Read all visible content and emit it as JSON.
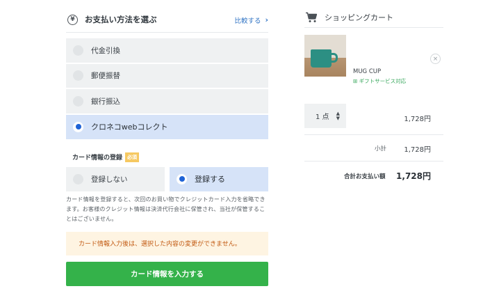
{
  "payment": {
    "title": "お支払い方法を選ぶ",
    "yen_symbol": "¥",
    "compare_link": "比較する",
    "options": [
      {
        "label": "代金引換",
        "selected": false
      },
      {
        "label": "郵便振替",
        "selected": false
      },
      {
        "label": "銀行振込",
        "selected": false
      },
      {
        "label": "クロネコwebコレクト",
        "selected": true
      }
    ]
  },
  "card_registration": {
    "title": "カード情報の登録",
    "required_badge": "必須",
    "options": [
      {
        "label": "登録しない",
        "selected": false
      },
      {
        "label": "登録する",
        "selected": true
      }
    ],
    "note": "カード情報を登録すると、次回のお買い物でクレジットカード入力を省略できます。お客様のクレジット情報は決済代行会社に保管され、当社が保管することはございません。",
    "warning": "カード情報入力後は、選択した内容の変更ができません。",
    "submit_label": "カード情報を入力する"
  },
  "cart": {
    "title": "ショッピングカート",
    "items": [
      {
        "name": "MUG CUP",
        "gift": "ギフトサービス対応",
        "quantity": "1 点",
        "price": "1,728円"
      }
    ],
    "subtotal_label": "小計",
    "subtotal_value": "1,728円",
    "total_label": "合計お支払い額",
    "total_value": "1,728円"
  },
  "colors": {
    "accent_blue": "#1f63d6",
    "selected_bg": "#d6e3f8",
    "option_bg": "#eff1f2",
    "submit_green": "#34b24a",
    "warning_bg": "#fef4e2",
    "warning_text": "#c25a12",
    "gift_green": "#35a65a",
    "link_blue": "#2f73c4"
  },
  "icons": {
    "payment": "yen-circle-icon",
    "compare": "chevron-right-icon",
    "cart": "shopping-cart-icon",
    "remove": "close-icon",
    "quantity": "updown-arrow-icon"
  }
}
